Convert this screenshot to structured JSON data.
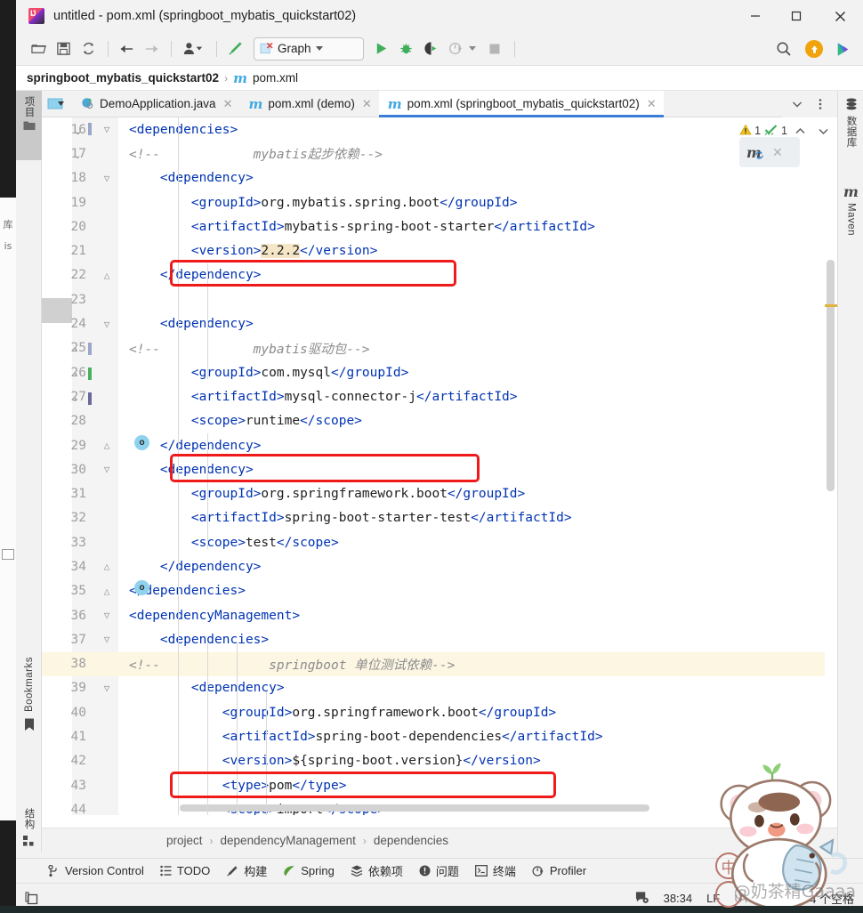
{
  "window": {
    "title": "untitled - pom.xml (springboot_mybatis_quickstart02)",
    "app_icon": "intellij-idea-icon",
    "minimize": "─",
    "maximize": "☐",
    "close": "✕"
  },
  "toolbar": {
    "items": [
      {
        "name": "open-folder-icon",
        "glyph": "🗁"
      },
      {
        "name": "save-all-icon",
        "glyph": "💾"
      },
      {
        "name": "sync-refresh-icon",
        "glyph": "⟳"
      },
      {
        "name": "navigate-back-icon",
        "glyph": "←"
      },
      {
        "name": "navigate-forward-icon",
        "glyph": "→"
      },
      {
        "name": "vcs-user-icon",
        "glyph": "👤"
      },
      {
        "name": "build-hammer-icon",
        "glyph": "⚒"
      }
    ],
    "run_config": {
      "label": "Graph",
      "icon": "run-config-broken-icon"
    },
    "run_icon": "run-play-icon",
    "debug_icon": "debug-bug-icon",
    "run_with_coverage_icon": "run-coverage-icon",
    "profiler_icon": "profiler-icon",
    "stop_icon": "stop-icon",
    "search_icon": "search-icon",
    "update_icon": "update-arrow-icon",
    "ide_icon": "ide-services-icon"
  },
  "navbar": {
    "project": "springboot_mybatis_quickstart02",
    "separator": "›",
    "file_icon": "maven-m-icon",
    "file": "pom.xml"
  },
  "left_strip": {
    "project_label": "项目",
    "project_icon": "project-tree-icon",
    "folder_icon": "folder-icon",
    "bookmarks_label": "Bookmarks",
    "bookmarks_icon": "bookmark-icon",
    "structure_label": "结构",
    "structure_icon": "structure-icon"
  },
  "right_strip": {
    "database_label": "数据库",
    "database_icon": "database-icon",
    "maven_label": "Maven",
    "maven_icon": "maven-m-icon"
  },
  "tabs": {
    "select_opened_file_icon": "select-opened-file-icon",
    "items": [
      {
        "label": "DemoApplication.java",
        "icon": "java-class-icon",
        "active": false,
        "close": "✕"
      },
      {
        "label": "pom.xml (demo)",
        "icon": "maven-m-icon",
        "active": false,
        "close": "✕"
      },
      {
        "label": "pom.xml (springboot_mybatis_quickstart02)",
        "icon": "maven-m-icon",
        "active": true,
        "close": "✕"
      }
    ],
    "chevron_icon": "chevron-down-icon",
    "more_icon": "more-vertical-icon"
  },
  "inspections": {
    "warning_icon": "warning-triangle-icon",
    "warning_count": "1",
    "ok_icon": "inspection-ok-icon",
    "ok_count": "1",
    "prev_icon": "chevron-up-icon",
    "next_icon": "chevron-down-icon"
  },
  "maven_popup": {
    "reload_icon": "maven-reload-icon",
    "close_icon": "close-icon"
  },
  "editor": {
    "first_line": 16,
    "cursor_marker": "|",
    "lines": [
      {
        "n": 16,
        "fold": "▽",
        "indent": 0,
        "tokens": [
          {
            "t": "tag",
            "v": "<dependencies>"
          }
        ]
      },
      {
        "n": 17,
        "fold": "",
        "indent": 0,
        "boxed": true,
        "tokens": [
          {
            "t": "cmt",
            "v": "<!--            mybatis起步依赖-->"
          }
        ]
      },
      {
        "n": 18,
        "fold": "▽",
        "indent": 1,
        "tokens": [
          {
            "t": "tag",
            "v": "<dependency>"
          }
        ]
      },
      {
        "n": 19,
        "fold": "",
        "indent": 2,
        "tokens": [
          {
            "t": "tag",
            "v": "<groupId>"
          },
          {
            "t": "plain",
            "v": "org.mybatis.spring.boot"
          },
          {
            "t": "tag",
            "v": "</groupId>"
          }
        ]
      },
      {
        "n": 20,
        "fold": "",
        "indent": 2,
        "tokens": [
          {
            "t": "tag",
            "v": "<artifactId>"
          },
          {
            "t": "plain",
            "v": "mybatis-spring-boot-starter"
          },
          {
            "t": "tag",
            "v": "</artifactId>"
          }
        ]
      },
      {
        "n": 21,
        "fold": "",
        "indent": 2,
        "tokens": [
          {
            "t": "tag",
            "v": "<version>"
          },
          {
            "t": "hl",
            "v": "2.2.2"
          },
          {
            "t": "tag",
            "v": "</version>"
          }
        ]
      },
      {
        "n": 22,
        "fold": "△",
        "indent": 1,
        "tokens": [
          {
            "t": "tag",
            "v": "</dependency>"
          }
        ]
      },
      {
        "n": 23,
        "fold": "",
        "indent": 0,
        "tokens": []
      },
      {
        "n": 24,
        "fold": "▽",
        "indent": 1,
        "maven": true,
        "tokens": [
          {
            "t": "tag",
            "v": "<dependency>"
          }
        ]
      },
      {
        "n": 25,
        "fold": "",
        "indent": 0,
        "boxed": true,
        "tokens": [
          {
            "t": "cmt",
            "v": "<!--            mybatis驱动包-->"
          }
        ]
      },
      {
        "n": 26,
        "fold": "",
        "indent": 2,
        "tokens": [
          {
            "t": "tag",
            "v": "<groupId>"
          },
          {
            "t": "plain",
            "v": "com.mysql"
          },
          {
            "t": "tag",
            "v": "</groupId>"
          }
        ]
      },
      {
        "n": 27,
        "fold": "",
        "indent": 2,
        "tokens": [
          {
            "t": "tag",
            "v": "<artifactId>"
          },
          {
            "t": "plain",
            "v": "mysql-connector-j"
          },
          {
            "t": "tag",
            "v": "</artifactId>"
          }
        ]
      },
      {
        "n": 28,
        "fold": "",
        "indent": 2,
        "tokens": [
          {
            "t": "tag",
            "v": "<scope>"
          },
          {
            "t": "plain",
            "v": "runtime"
          },
          {
            "t": "tag",
            "v": "</scope>"
          }
        ]
      },
      {
        "n": 29,
        "fold": "△",
        "indent": 1,
        "tokens": [
          {
            "t": "tag",
            "v": "</dependency>"
          }
        ]
      },
      {
        "n": 30,
        "fold": "▽",
        "indent": 1,
        "maven": true,
        "tokens": [
          {
            "t": "tag",
            "v": "<dependency>"
          }
        ]
      },
      {
        "n": 31,
        "fold": "",
        "indent": 2,
        "tokens": [
          {
            "t": "tag",
            "v": "<groupId>"
          },
          {
            "t": "plain",
            "v": "org.springframework.boot"
          },
          {
            "t": "tag",
            "v": "</groupId>"
          }
        ]
      },
      {
        "n": 32,
        "fold": "",
        "indent": 2,
        "tokens": [
          {
            "t": "tag",
            "v": "<artifactId>"
          },
          {
            "t": "plain",
            "v": "spring-boot-starter-test"
          },
          {
            "t": "tag",
            "v": "</artifactId>"
          }
        ]
      },
      {
        "n": 33,
        "fold": "",
        "indent": 2,
        "tokens": [
          {
            "t": "tag",
            "v": "<scope>"
          },
          {
            "t": "plain",
            "v": "test"
          },
          {
            "t": "tag",
            "v": "</scope>"
          }
        ]
      },
      {
        "n": 34,
        "fold": "△",
        "indent": 1,
        "tokens": [
          {
            "t": "tag",
            "v": "</dependency>"
          }
        ]
      },
      {
        "n": 35,
        "fold": "△",
        "indent": 0,
        "tokens": [
          {
            "t": "tag",
            "v": "</dependencies>"
          }
        ]
      },
      {
        "n": 36,
        "fold": "▽",
        "indent": 0,
        "tokens": [
          {
            "t": "tag",
            "v": "<dependencyManagement>"
          }
        ]
      },
      {
        "n": 37,
        "fold": "▽",
        "indent": 1,
        "tokens": [
          {
            "t": "tag",
            "v": "<dependencies>"
          }
        ]
      },
      {
        "n": 38,
        "fold": "",
        "indent": 0,
        "boxed": true,
        "current": true,
        "tokens": [
          {
            "t": "cmt",
            "v": "<!--              springboot 单位测试依赖-->"
          }
        ]
      },
      {
        "n": 39,
        "fold": "▽",
        "indent": 2,
        "tokens": [
          {
            "t": "tag",
            "v": "<dependency>"
          }
        ]
      },
      {
        "n": 40,
        "fold": "",
        "indent": 3,
        "tokens": [
          {
            "t": "tag",
            "v": "<groupId>"
          },
          {
            "t": "plain",
            "v": "org.springframework.boot"
          },
          {
            "t": "tag",
            "v": "</groupId>"
          }
        ]
      },
      {
        "n": 41,
        "fold": "",
        "indent": 3,
        "tokens": [
          {
            "t": "tag",
            "v": "<artifactId>"
          },
          {
            "t": "plain",
            "v": "spring-boot-dependencies"
          },
          {
            "t": "tag",
            "v": "</artifactId>"
          }
        ]
      },
      {
        "n": 42,
        "fold": "",
        "indent": 3,
        "tokens": [
          {
            "t": "tag",
            "v": "<version>"
          },
          {
            "t": "plain",
            "v": "${spring-boot.version}"
          },
          {
            "t": "tag",
            "v": "</version>"
          }
        ]
      },
      {
        "n": 43,
        "fold": "",
        "indent": 3,
        "tokens": [
          {
            "t": "tag",
            "v": "<type>"
          },
          {
            "t": "plain",
            "v": "pom"
          },
          {
            "t": "tag",
            "v": "</type>"
          }
        ]
      },
      {
        "n": 44,
        "fold": "",
        "indent": 3,
        "tokens": [
          {
            "t": "tag",
            "v": "<scope>"
          },
          {
            "t": "plain",
            "v": "import"
          },
          {
            "t": "tag",
            "v": "</scope>"
          }
        ]
      }
    ]
  },
  "editor_crumbs": {
    "items": [
      "project",
      "dependencyManagement",
      "dependencies"
    ],
    "separator": "›"
  },
  "bottom_bar": {
    "items": [
      {
        "label": "Version Control",
        "icon": "branch-icon"
      },
      {
        "label": "TODO",
        "icon": "todo-list-icon"
      },
      {
        "label": "构建",
        "icon": "build-hammer-icon"
      },
      {
        "label": "Spring",
        "icon": "spring-leaf-icon"
      },
      {
        "label": "依赖项",
        "icon": "dependencies-stack-icon"
      },
      {
        "label": "问题",
        "icon": "problems-icon"
      },
      {
        "label": "终端",
        "icon": "terminal-icon"
      },
      {
        "label": "Profiler",
        "icon": "profiler-icon"
      }
    ]
  },
  "statusbar": {
    "layout_icon": "layout-icon",
    "inspection_icon": "inspection-settings-icon",
    "caret_position": "38:34",
    "line_separator": "LF",
    "encoding": "UTF-8",
    "read_only_icon": "eye-icon",
    "indent": "4 个空格",
    "ime": "中"
  },
  "watermark": {
    "handle": "@奶茶精Gaaaa",
    "sticker": "bear-with-fish-sticker"
  },
  "colors": {
    "accent_blue": "#3a7fd5",
    "tag_blue": "#0033b3",
    "comment_grey": "#8c8c8c",
    "annotation_red": "#f01a1a",
    "highlight_yellow": "#f5e6c8",
    "current_line": "#fdf6e3"
  }
}
